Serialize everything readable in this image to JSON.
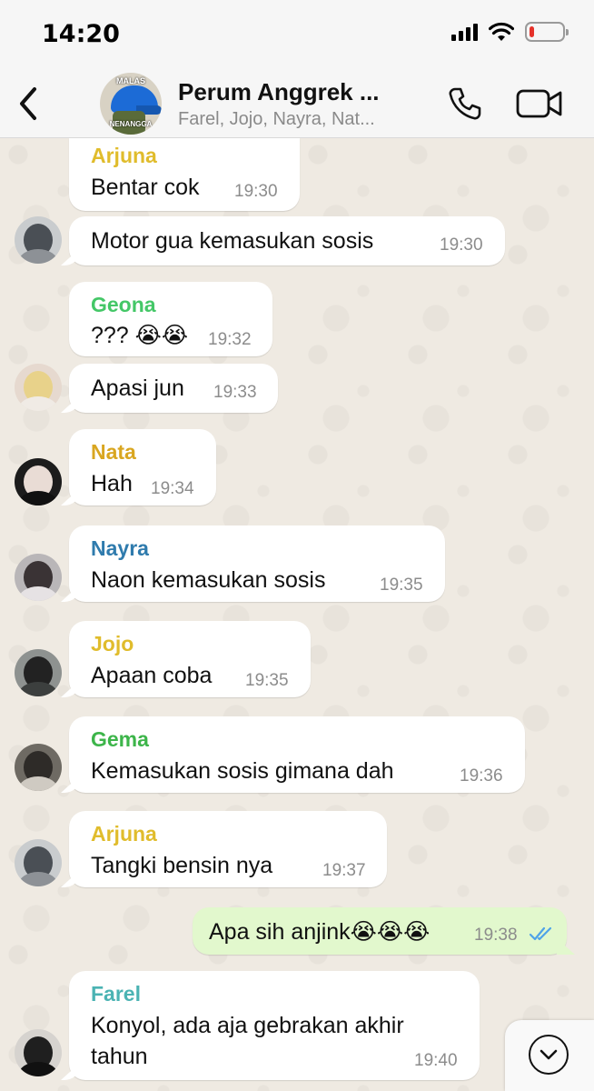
{
  "status_bar": {
    "time": "14:20",
    "battery_level": 0.15,
    "battery_color": "#e5312a"
  },
  "header": {
    "back_icon": "chevron-left-icon",
    "group_name": "Perum Anggrek ...",
    "members": "Farel, Jojo, Nayra, Nat...",
    "avatar_text_top": "MALAS",
    "avatar_text_bottom": "NENANGGA",
    "call_icon": "phone-icon",
    "video_icon": "video-camera-icon"
  },
  "messages": [
    {
      "sender": "Arjuna",
      "sender_color": "#e0bc2c",
      "text": "Bentar cok",
      "time": "19:30"
    },
    {
      "sender": "",
      "text": "Motor gua kemasukan sosis",
      "time": "19:30"
    },
    {
      "sender": "Geona",
      "sender_color": "#44c767",
      "text": "??? 😭😭",
      "time": "19:32"
    },
    {
      "sender": "",
      "text": "Apasi jun",
      "time": "19:33"
    },
    {
      "sender": "Nata",
      "sender_color": "#d9a620",
      "text": "Hah",
      "time": "19:34"
    },
    {
      "sender": "Nayra",
      "sender_color": "#2f7bad",
      "text": "Naon kemasukan sosis",
      "time": "19:35"
    },
    {
      "sender": "Jojo",
      "sender_color": "#e0bc2c",
      "text": "Apaan coba",
      "time": "19:35"
    },
    {
      "sender": "Gema",
      "sender_color": "#3db54a",
      "text": "Kemasukan sosis gimana dah",
      "time": "19:36"
    },
    {
      "sender": "Arjuna",
      "sender_color": "#e0bc2c",
      "text": "Tangki bensin nya",
      "time": "19:37"
    },
    {
      "sender": "",
      "outgoing": true,
      "text": "Apa sih anjink😭😭😭",
      "time": "19:38",
      "read_icon": "double-check-icon",
      "read_color": "#4fa3e8"
    },
    {
      "sender": "Farel",
      "sender_color": "#4bb3b3",
      "text": "Konyol, ada aja gebrakan akhir",
      "text_line2": "tahun",
      "time": "19:40"
    }
  ],
  "scroll_down_icon": "chevron-down-icon"
}
